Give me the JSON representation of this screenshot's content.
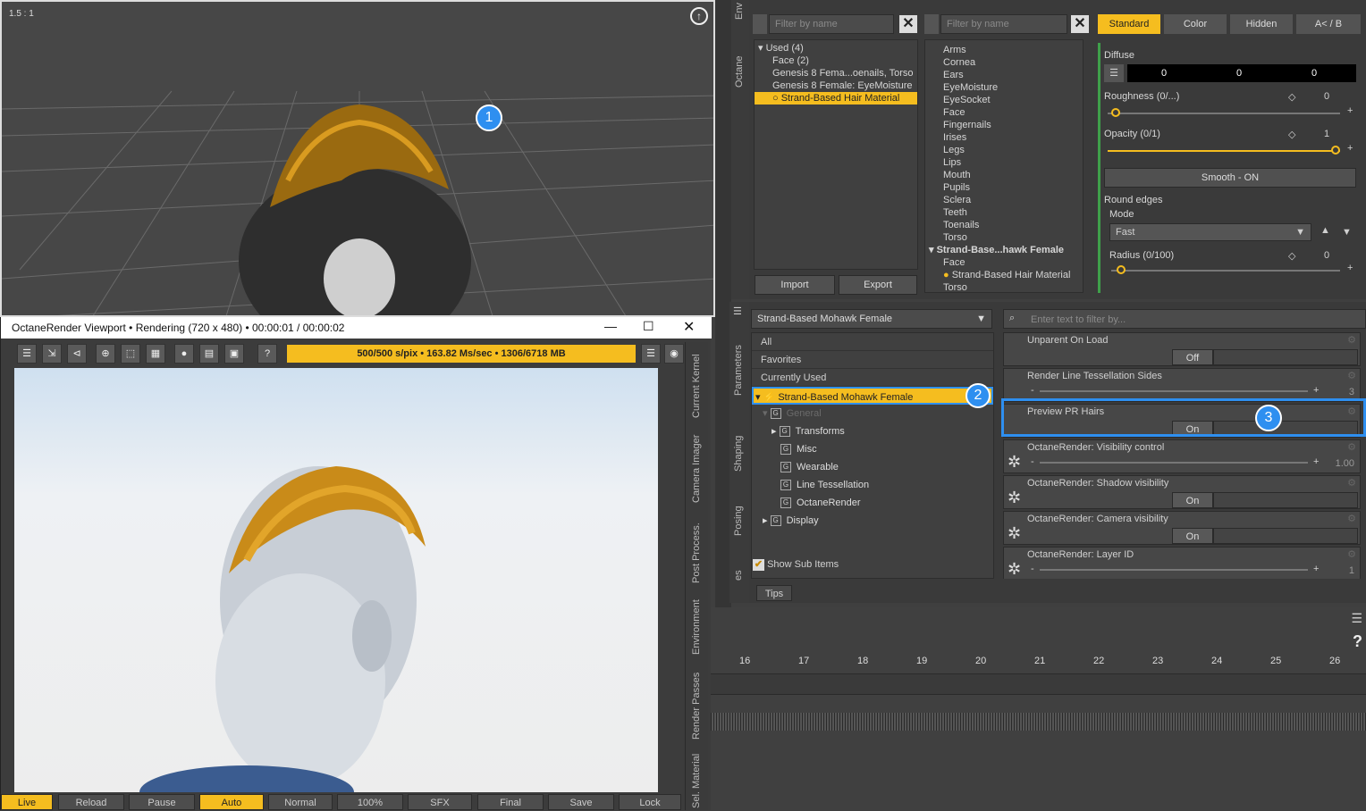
{
  "viewport": {
    "ratio": "1.5 : 1",
    "callout1": "1"
  },
  "render_window": {
    "title": "OctaneRender Viewport • Rendering (720 x 480) • 00:00:01 / 00:00:02",
    "progress": "500/500 s/pix • 163.82 Ms/sec • 1306/6718 MB",
    "side_tabs": [
      "Current Kernel",
      "Camera Imager",
      "Post Process.",
      "Environment",
      "Render Passes",
      "Sel. Material"
    ],
    "bottom_buttons": [
      "Live",
      "Reload",
      "Pause",
      "Auto",
      "Normal",
      "100%",
      "SFX",
      "Final",
      "Save",
      "Lock"
    ]
  },
  "surfaces": {
    "side_tabs": [
      "Env",
      "Octane"
    ],
    "filter_placeholder": "Filter by name",
    "used": {
      "header": "Used (4)",
      "items": [
        "Face (2)",
        "Genesis 8 Fema...oenails, Torso",
        "Genesis 8 Female: EyeMoisture",
        "Strand-Based Hair Material"
      ]
    },
    "import": "Import",
    "export": "Export",
    "surface_list": [
      "Arms",
      "Cornea",
      "Ears",
      "EyeMoisture",
      "EyeSocket",
      "Face",
      "Fingernails",
      "Irises",
      "Legs",
      "Lips",
      "Mouth",
      "Pupils",
      "Sclera",
      "Teeth",
      "Toenails",
      "Torso"
    ],
    "group_header": "Strand-Base...hawk Female",
    "group_items": [
      "Face",
      "Strand-Based Hair Material",
      "Torso"
    ]
  },
  "material": {
    "tabs": [
      "Standard",
      "Color",
      "Hidden",
      "A< / B"
    ],
    "diffuse": "Diffuse",
    "diffuse_values": [
      "0",
      "0",
      "0"
    ],
    "roughness": "Roughness (0/...)",
    "roughness_val": "0",
    "opacity": "Opacity (0/1)",
    "opacity_val": "1",
    "smooth": "Smooth - ON",
    "round_edges": "Round edges",
    "mode": "Mode",
    "mode_val": "Fast",
    "radius": "Radius (0/100)",
    "radius_val": "0"
  },
  "params": {
    "side_tabs": [
      "Parameters",
      "Shaping",
      "Posing",
      "es"
    ],
    "node_select": "Strand-Based Mohawk Female",
    "filter_placeholder": "Enter text to filter by...",
    "categories": [
      "All",
      "Favorites",
      "Currently Used"
    ],
    "selected_node": "Strand-Based Mohawk Female",
    "callout2": "2",
    "callout3": "3",
    "general": "General",
    "groups": [
      "Transforms",
      "Misc",
      "Wearable",
      "Line Tessellation",
      "OctaneRender"
    ],
    "display": "Display",
    "show_sub": "Show Sub Items",
    "tips": "Tips",
    "rows": [
      {
        "label": "Unparent On Load",
        "value": "Off"
      },
      {
        "label": "Render Line Tessellation Sides",
        "value": "3"
      },
      {
        "label": "Preview PR Hairs",
        "value": "On"
      },
      {
        "label": "OctaneRender: Visibility control",
        "value": "1.00"
      },
      {
        "label": "OctaneRender: Shadow visibility",
        "value": "On"
      },
      {
        "label": "OctaneRender: Camera visibility",
        "value": "On"
      },
      {
        "label": "OctaneRender: Layer ID",
        "value": "1"
      }
    ]
  },
  "timeline": {
    "ticks": [
      "16",
      "17",
      "18",
      "19",
      "20",
      "21",
      "22",
      "23",
      "24",
      "25",
      "26"
    ],
    "help": "?"
  }
}
